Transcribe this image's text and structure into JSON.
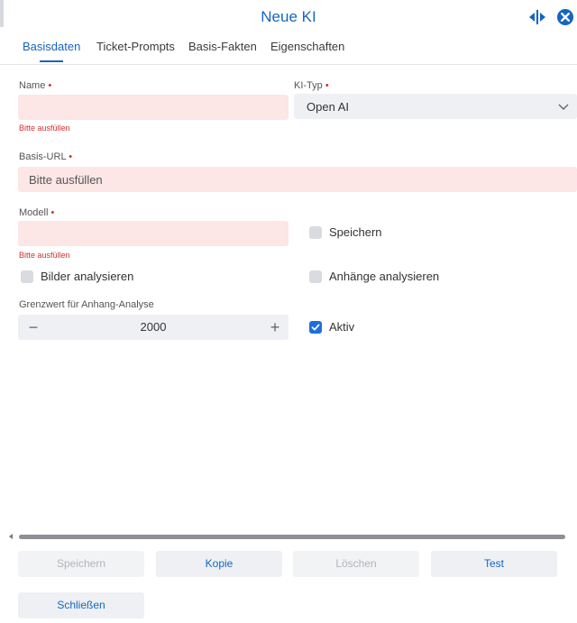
{
  "header": {
    "title": "Neue KI",
    "resize_icon": "split-arrows-icon",
    "close_icon": "close-circle-icon",
    "accent_color": "#1565c0"
  },
  "tabs": [
    {
      "label": "Basisdaten",
      "active": true
    },
    {
      "label": "Ticket-Prompts",
      "active": false
    },
    {
      "label": "Basis-Fakten",
      "active": false
    },
    {
      "label": "Eigenschaften",
      "active": false
    }
  ],
  "form": {
    "name": {
      "label": "Name",
      "required_marker": "•",
      "value": "",
      "error": "Bitte ausfüllen"
    },
    "ki_typ": {
      "label": "KI-Typ",
      "required_marker": "•",
      "selected": "Open AI"
    },
    "basis_url": {
      "label": "Basis-URL",
      "required_marker": "•",
      "value": "",
      "placeholder": "Bitte ausfüllen"
    },
    "modell": {
      "label": "Modell",
      "required_marker": "•",
      "value": "",
      "error": "Bitte ausfüllen"
    },
    "speichern_checkbox": {
      "label": "Speichern",
      "checked": false
    },
    "bilder_analysieren": {
      "label": "Bilder analysieren",
      "checked": false
    },
    "anhaenge_analysieren": {
      "label": "Anhänge analysieren",
      "checked": false
    },
    "grenzwert": {
      "label": "Grenzwert für Anhang-Analyse",
      "value": "2000",
      "minus": "−",
      "plus": "+"
    },
    "aktiv": {
      "label": "Aktiv",
      "checked": true
    }
  },
  "buttons": {
    "speichern": "Speichern",
    "kopie": "Kopie",
    "loeschen": "Löschen",
    "test": "Test",
    "schliessen": "Schließen"
  }
}
